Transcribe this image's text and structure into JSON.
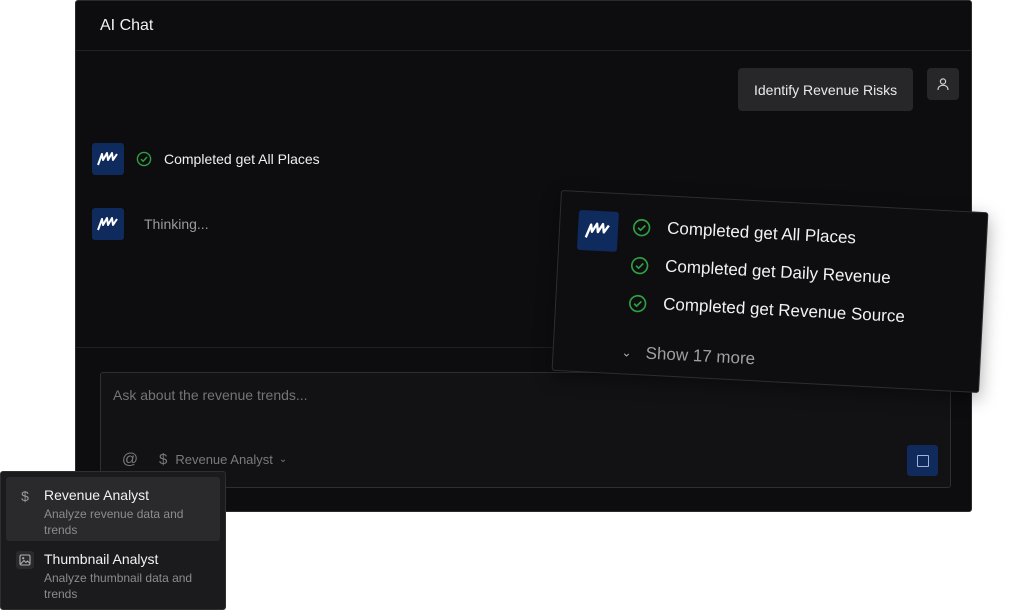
{
  "window": {
    "title": "AI Chat"
  },
  "conversation": {
    "user_message": "Identify Revenue Risks",
    "bot_status": "Completed get All Places",
    "thinking": "Thinking..."
  },
  "composer": {
    "placeholder": "Ask about the revenue trends...",
    "mention_symbol": "@",
    "agent_label": "Revenue Analyst"
  },
  "tool_card": {
    "items": [
      "Completed get All Places",
      "Completed get Daily Revenue",
      "Completed get Revenue Source"
    ],
    "show_more": "Show 17 more"
  },
  "agent_menu": {
    "options": [
      {
        "title": "Revenue Analyst",
        "description": "Analyze revenue data and trends",
        "icon": "dollar-icon"
      },
      {
        "title": "Thumbnail Analyst",
        "description": "Analyze thumbnail data and trends",
        "icon": "image-icon"
      }
    ]
  },
  "colors": {
    "background": "#0d0c0e",
    "accent": "#0f2a5c",
    "success": "#2ea043",
    "surface": "#27272a"
  }
}
